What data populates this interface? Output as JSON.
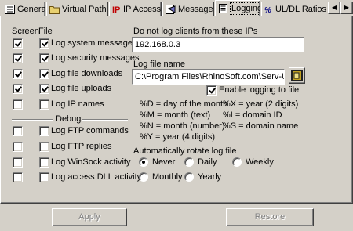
{
  "tabs": [
    {
      "label": "General",
      "icon": "settings-list-icon"
    },
    {
      "label": "Virtual Paths",
      "icon": "folder-icon"
    },
    {
      "label": "IP Access",
      "icon": "ip-icon"
    },
    {
      "label": "Messages",
      "icon": "messages-icon"
    },
    {
      "label": "Logging",
      "icon": "log-icon",
      "active": true
    },
    {
      "label": "UL/DL Ratios",
      "icon": "ratio-icon"
    }
  ],
  "columns": {
    "screen": "Screen",
    "file": "File"
  },
  "log_options": [
    {
      "label": "Log system messages",
      "screen": true,
      "file": true
    },
    {
      "label": "Log security messages",
      "screen": true,
      "file": true
    },
    {
      "label": "Log file downloads",
      "screen": true,
      "file": true
    },
    {
      "label": "Log file uploads",
      "screen": true,
      "file": true
    },
    {
      "label": "Log IP names",
      "screen": false,
      "file": false
    }
  ],
  "debug": {
    "title": "Debug",
    "options": [
      {
        "label": "Log FTP commands",
        "screen": false,
        "file": false
      },
      {
        "label": "Log FTP replies",
        "screen": false,
        "file": false
      },
      {
        "label": "Log WinSock activity",
        "screen": false,
        "file": false
      },
      {
        "label": "Log access DLL activity",
        "screen": false,
        "file": false
      }
    ]
  },
  "exclude_ips": {
    "label": "Do not log clients from these IPs",
    "value": "192.168.0.3"
  },
  "log_file": {
    "label": "Log file name",
    "value": "C:\\Program Files\\RhinoSoft.com\\Serv-U\\spiker.",
    "enable_label": "Enable logging to file",
    "enabled": true
  },
  "date_codes": [
    {
      "left": "%D = day of the month",
      "right": "%X = year (2 digits)"
    },
    {
      "left": "%M = month (text)",
      "right": "%I = domain ID"
    },
    {
      "left": "%N = month (number)",
      "right": "%S = domain name"
    },
    {
      "left": "%Y = year (4 digits)",
      "right": ""
    }
  ],
  "rotate": {
    "label": "Automatically rotate log file",
    "options": [
      {
        "label": "Never",
        "selected": true
      },
      {
        "label": "Daily",
        "selected": false
      },
      {
        "label": "Weekly",
        "selected": false
      },
      {
        "label": "Monthly",
        "selected": false
      },
      {
        "label": "Yearly",
        "selected": false
      }
    ]
  },
  "buttons": {
    "apply": "Apply",
    "restore": "Restore"
  }
}
